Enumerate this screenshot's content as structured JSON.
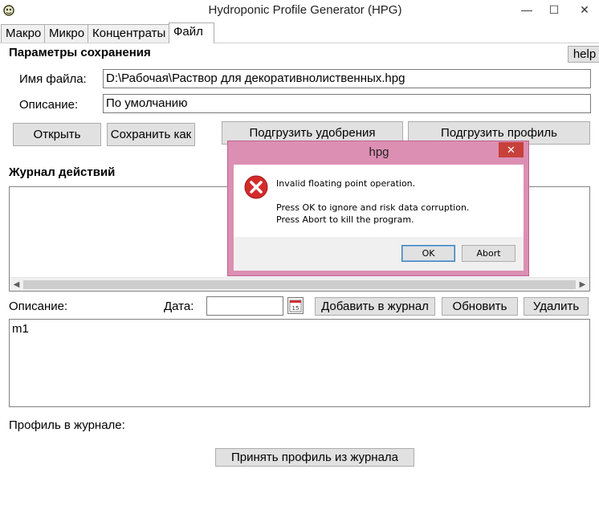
{
  "window": {
    "title": "Hydroponic Profile Generator (HPG)",
    "minimize": "—",
    "maximize": "☐",
    "close": "✕"
  },
  "tabs": [
    {
      "label": "Макро",
      "active": false
    },
    {
      "label": "Микро",
      "active": false
    },
    {
      "label": "Концентраты",
      "active": false
    },
    {
      "label": "Файл",
      "active": true
    }
  ],
  "help_label": "help",
  "save_params": {
    "heading": "Параметры сохранения",
    "filename_label": "Имя файла:",
    "filename_value": "D:\\Рабочая\\Раствор для декоративнолиственных.hpg",
    "description_label": "Описание:",
    "description_value": "По умолчанию"
  },
  "buttons": {
    "open": "Открыть",
    "save_as": "Сохранить как",
    "load_fertilizers": "Подгрузить удобрения",
    "load_profile": "Подгрузить профиль",
    "add_to_log": "Добавить в журнал",
    "refresh": "Обновить",
    "delete": "Удалить",
    "accept_profile": "Принять профиль из журнала"
  },
  "log": {
    "heading": "Журнал действий",
    "description_label": "Описание:",
    "date_label": "Дата:",
    "date_value": "",
    "calendar_day": "15",
    "notes_text": "m1",
    "profile_label": "Профиль в журнале:"
  },
  "dialog": {
    "title": "hpg",
    "close": "✕",
    "message_line1": "Invalid floating point operation.",
    "message_line2": "Press OK to ignore and risk data corruption.",
    "message_line3": "Press Abort to kill the program.",
    "ok_label": "OK",
    "abort_label": "Abort"
  },
  "colors": {
    "dialog_frame": "#dd8fb3",
    "dialog_close": "#c7413a",
    "error_icon": "#d42b2b"
  }
}
